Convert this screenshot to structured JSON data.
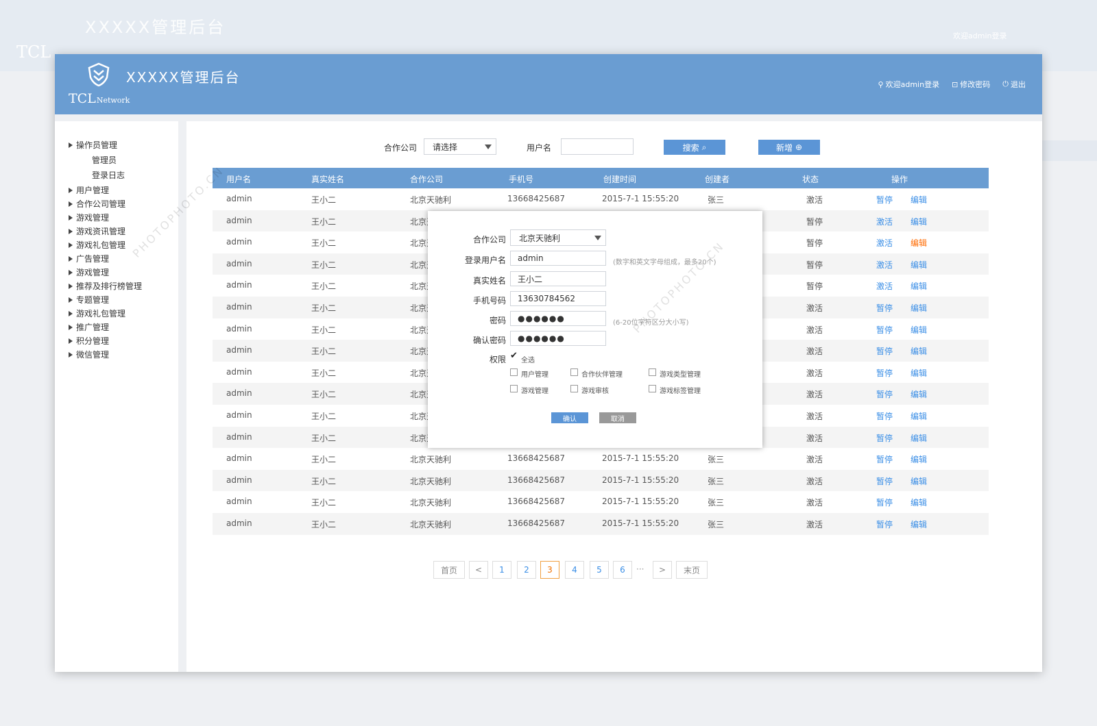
{
  "app": {
    "title": "XXXXX管理后台",
    "brand": "TCL",
    "brand_suffix": "Network"
  },
  "header_links": {
    "welcome": "欢迎admin登录",
    "change_password": "修改密码",
    "logout": "退出"
  },
  "sidebar": {
    "items": [
      {
        "label": "操作员管理",
        "children": [
          "管理员",
          "登录日志"
        ]
      },
      {
        "label": "用户管理"
      },
      {
        "label": "合作公司管理"
      },
      {
        "label": "游戏管理"
      },
      {
        "label": "游戏资讯管理"
      },
      {
        "label": "游戏礼包管理"
      },
      {
        "label": "广告管理"
      },
      {
        "label": "游戏管理"
      },
      {
        "label": "推荐及排行榜管理"
      },
      {
        "label": "专题管理"
      },
      {
        "label": "游戏礼包管理"
      },
      {
        "label": "推广管理"
      },
      {
        "label": "积分管理"
      },
      {
        "label": "微信管理"
      }
    ]
  },
  "search": {
    "company_label": "合作公司",
    "company_value": "请选择",
    "username_label": "用户名",
    "username_value": "",
    "search_button": "搜索",
    "add_button": "新增"
  },
  "table": {
    "columns": [
      "用户名",
      "真实姓名",
      "合作公司",
      "手机号",
      "创建时间",
      "创建者",
      "状态",
      "操作"
    ],
    "rows": [
      {
        "username": "admin",
        "realname": "王小二",
        "company": "北京天驰利",
        "phone": "13668425687",
        "created": "2015-7-1 15:55:20",
        "creator": "张三",
        "status": "激活",
        "action1": "暂停",
        "action2": "编辑"
      },
      {
        "username": "admin",
        "realname": "王小二",
        "company": "北京天",
        "phone": "",
        "created": "",
        "creator": "",
        "status": "暂停",
        "action1": "激活",
        "action2": "编辑"
      },
      {
        "username": "admin",
        "realname": "王小二",
        "company": "北京天",
        "phone": "",
        "created": "",
        "creator": "",
        "status": "暂停",
        "action1": "激活",
        "action2": "编辑"
      },
      {
        "username": "admin",
        "realname": "王小二",
        "company": "北京天",
        "phone": "",
        "created": "",
        "creator": "",
        "status": "暂停",
        "action1": "激活",
        "action2": "编辑"
      },
      {
        "username": "admin",
        "realname": "王小二",
        "company": "北京天",
        "phone": "",
        "created": "",
        "creator": "",
        "status": "暂停",
        "action1": "激活",
        "action2": "编辑"
      },
      {
        "username": "admin",
        "realname": "王小二",
        "company": "北京天",
        "phone": "",
        "created": "",
        "creator": "",
        "status": "激活",
        "action1": "暂停",
        "action2": "编辑"
      },
      {
        "username": "admin",
        "realname": "王小二",
        "company": "北京天",
        "phone": "",
        "created": "",
        "creator": "",
        "status": "激活",
        "action1": "暂停",
        "action2": "编辑"
      },
      {
        "username": "admin",
        "realname": "王小二",
        "company": "北京天",
        "phone": "",
        "created": "",
        "creator": "",
        "status": "激活",
        "action1": "暂停",
        "action2": "编辑"
      },
      {
        "username": "admin",
        "realname": "王小二",
        "company": "北京天",
        "phone": "",
        "created": "",
        "creator": "",
        "status": "激活",
        "action1": "暂停",
        "action2": "编辑"
      },
      {
        "username": "admin",
        "realname": "王小二",
        "company": "北京天",
        "phone": "",
        "created": "",
        "creator": "",
        "status": "激活",
        "action1": "暂停",
        "action2": "编辑"
      },
      {
        "username": "admin",
        "realname": "王小二",
        "company": "北京天",
        "phone": "",
        "created": "",
        "creator": "",
        "status": "激活",
        "action1": "暂停",
        "action2": "编辑"
      },
      {
        "username": "admin",
        "realname": "王小二",
        "company": "北京天",
        "phone": "",
        "created": "",
        "creator": "",
        "status": "激活",
        "action1": "暂停",
        "action2": "编辑"
      },
      {
        "username": "admin",
        "realname": "王小二",
        "company": "北京天驰利",
        "phone": "13668425687",
        "created": "2015-7-1 15:55:20",
        "creator": "张三",
        "status": "激活",
        "action1": "暂停",
        "action2": "编辑"
      },
      {
        "username": "admin",
        "realname": "王小二",
        "company": "北京天驰利",
        "phone": "13668425687",
        "created": "2015-7-1 15:55:20",
        "creator": "张三",
        "status": "激活",
        "action1": "暂停",
        "action2": "编辑"
      },
      {
        "username": "admin",
        "realname": "王小二",
        "company": "北京天驰利",
        "phone": "13668425687",
        "created": "2015-7-1 15:55:20",
        "creator": "张三",
        "status": "激活",
        "action1": "暂停",
        "action2": "编辑"
      },
      {
        "username": "admin",
        "realname": "王小二",
        "company": "北京天驰利",
        "phone": "13668425687",
        "created": "2015-7-1 15:55:20",
        "creator": "张三",
        "status": "激活",
        "action1": "暂停",
        "action2": "编辑"
      }
    ]
  },
  "pagination": {
    "first": "首页",
    "prev": "<",
    "pages": [
      "1",
      "2",
      "3",
      "4",
      "5",
      "6"
    ],
    "current": "3",
    "ellipsis": "···",
    "next": ">",
    "last": "末页"
  },
  "modal": {
    "company_label": "合作公司",
    "company_value": "北京天驰利",
    "login_label": "登录用户名",
    "login_value": "admin",
    "login_hint": "(数字和英文字母组成，最多20个)",
    "realname_label": "真实姓名",
    "realname_value": "王小二",
    "phone_label": "手机号码",
    "phone_value": "13630784562",
    "password_label": "密码",
    "password_value": "●●●●●●",
    "password_hint": "(6-20位字符区分大小写)",
    "confirm_label": "确认密码",
    "confirm_value": "●●●●●●",
    "perm_label": "权限",
    "select_all": "全选",
    "permissions": [
      "用户管理",
      "合作伙伴管理",
      "游戏类型管理",
      "游戏管理",
      "游戏审核",
      "游戏标签管理"
    ],
    "ok_button": "确认",
    "cancel_button": "取消"
  },
  "watermark": {
    "text": "PHOTOPHOTO.CN"
  },
  "colors": {
    "header": "#6a9dd2",
    "button": "#5b95d6",
    "link": "#3a8ee6",
    "highlight": "#ff6a00"
  }
}
